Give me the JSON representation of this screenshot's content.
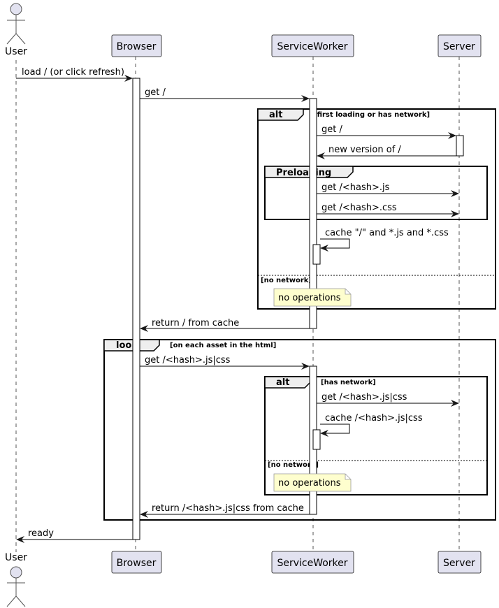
{
  "participants": {
    "user": "User",
    "browser": "Browser",
    "service_worker": "ServiceWorker",
    "server": "Server"
  },
  "messages": [
    "load / (or click refresh)",
    "get /",
    "get /",
    "new version of /",
    "get /<hash>.js",
    "get /<hash>.css",
    "cache \"/\" and *.js and *.css",
    "return / from cache",
    "get /<hash>.js|css",
    "get /<hash>.js|css",
    "cache /<hash>.js|css",
    "return /<hash>.js|css from cache",
    "ready"
  ],
  "frames": {
    "alt1": {
      "kind": "alt",
      "guard": "[first loading or has network]",
      "else_guard": "[no network]"
    },
    "preloading": {
      "kind": "Preloading"
    },
    "loop": {
      "kind": "loop",
      "guard": "[on each asset in the html]"
    },
    "alt2": {
      "kind": "alt",
      "guard": "[has network]",
      "else_guard": "[no network]"
    }
  },
  "notes": [
    "no operations",
    "no operations"
  ],
  "colors": {
    "participant_fill": "#e2e2f0",
    "note_fill": "#fefece",
    "frame_tab_fill": "#eeeeee"
  }
}
